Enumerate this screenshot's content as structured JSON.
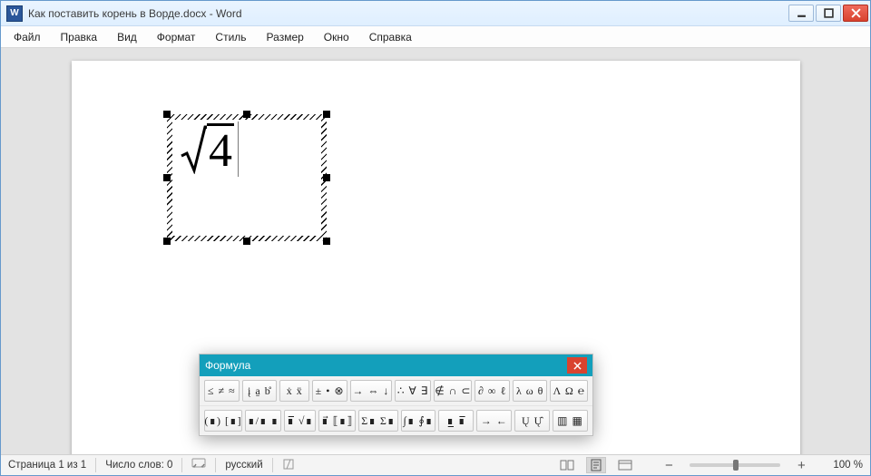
{
  "titlebar": {
    "icon_text": "W",
    "title": "Как поставить корень в Ворде.docx - Word"
  },
  "menu": {
    "items": [
      "Файл",
      "Правка",
      "Вид",
      "Формат",
      "Стиль",
      "Размер",
      "Окно",
      "Справка"
    ]
  },
  "formula_object": {
    "radicand": "4"
  },
  "formula_toolbar": {
    "title": "Формула",
    "row1": [
      "≤ ≠ ≈",
      "į a̱ b̊",
      "ẋ ẍ",
      "± • ⊗",
      "→ ⇔ ↓",
      "∴ ∀ ∃",
      "∉ ∩ ⊂",
      "∂ ∞ ℓ",
      "λ ω θ",
      "Λ Ω ℮"
    ],
    "row2": [
      "(∎) [∎]",
      "∎/∎ ∎",
      "∎̅ √∎",
      "∎⃗ ⟦∎⟧",
      "Σ∎ Σ∎",
      "∫∎ ∮∎",
      "∎̲ ∎̅",
      "→ ←",
      "Ų Ų̂",
      "▥ ▦"
    ]
  },
  "status": {
    "page_info": "Страница 1 из 1",
    "word_count_label": "Число слов:",
    "word_count": "0",
    "language": "русский",
    "zoom_text": "100 %"
  }
}
